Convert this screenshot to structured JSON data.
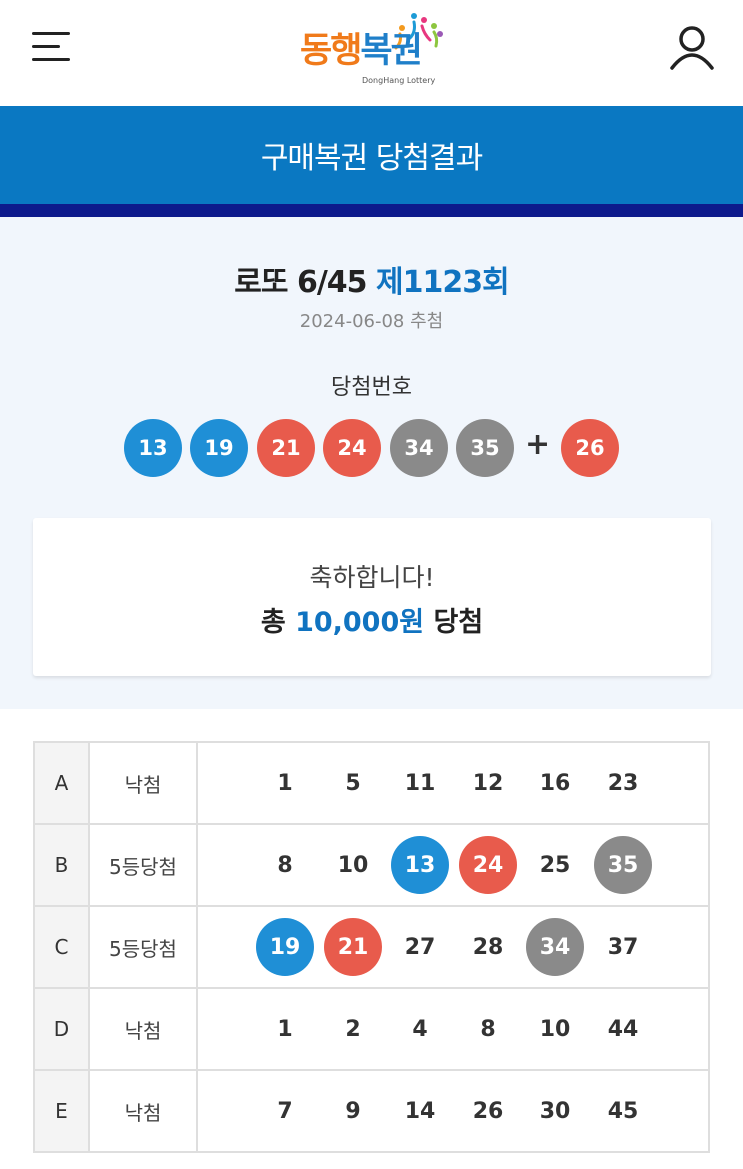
{
  "header": {
    "logo": {
      "text_1": "동행",
      "text_2": "복권",
      "subtitle": "DongHang Lottery"
    }
  },
  "title_bar": {
    "title": "구매복권 당첨결과"
  },
  "summary": {
    "game_name": "로또 6/45",
    "round": "제1123회",
    "draw_date": "2024-06-08 추첨",
    "winning_label": "당첨번호",
    "winning_numbers": [
      {
        "value": "13",
        "color": "#1f8fd6"
      },
      {
        "value": "19",
        "color": "#1f8fd6"
      },
      {
        "value": "21",
        "color": "#e85b4c"
      },
      {
        "value": "24",
        "color": "#e85b4c"
      },
      {
        "value": "34",
        "color": "#8a8a8a"
      },
      {
        "value": "35",
        "color": "#8a8a8a"
      }
    ],
    "plus_sign": "+",
    "bonus_number": {
      "value": "26",
      "color": "#e85b4c"
    },
    "congrats_text": "축하합니다!",
    "total_prefix": "총",
    "total_amount": "10,000원",
    "total_suffix": "당첨"
  },
  "games": [
    {
      "label": "A",
      "status": "낙첨",
      "numbers": [
        {
          "value": "1",
          "hit": false
        },
        {
          "value": "5",
          "hit": false
        },
        {
          "value": "11",
          "hit": false
        },
        {
          "value": "12",
          "hit": false
        },
        {
          "value": "16",
          "hit": false
        },
        {
          "value": "23",
          "hit": false
        }
      ]
    },
    {
      "label": "B",
      "status": "5등당첨",
      "numbers": [
        {
          "value": "8",
          "hit": false
        },
        {
          "value": "10",
          "hit": false
        },
        {
          "value": "13",
          "hit": true,
          "color": "#1f8fd6"
        },
        {
          "value": "24",
          "hit": true,
          "color": "#e85b4c"
        },
        {
          "value": "25",
          "hit": false
        },
        {
          "value": "35",
          "hit": true,
          "color": "#8a8a8a"
        }
      ]
    },
    {
      "label": "C",
      "status": "5등당첨",
      "numbers": [
        {
          "value": "19",
          "hit": true,
          "color": "#1f8fd6"
        },
        {
          "value": "21",
          "hit": true,
          "color": "#e85b4c"
        },
        {
          "value": "27",
          "hit": false
        },
        {
          "value": "28",
          "hit": false
        },
        {
          "value": "34",
          "hit": true,
          "color": "#8a8a8a"
        },
        {
          "value": "37",
          "hit": false
        }
      ]
    },
    {
      "label": "D",
      "status": "낙첨",
      "numbers": [
        {
          "value": "1",
          "hit": false
        },
        {
          "value": "2",
          "hit": false
        },
        {
          "value": "4",
          "hit": false
        },
        {
          "value": "8",
          "hit": false
        },
        {
          "value": "10",
          "hit": false
        },
        {
          "value": "44",
          "hit": false
        }
      ]
    },
    {
      "label": "E",
      "status": "낙첨",
      "numbers": [
        {
          "value": "7",
          "hit": false
        },
        {
          "value": "9",
          "hit": false
        },
        {
          "value": "14",
          "hit": false
        },
        {
          "value": "26",
          "hit": false
        },
        {
          "value": "30",
          "hit": false
        },
        {
          "value": "45",
          "hit": false
        }
      ]
    }
  ],
  "colors": {
    "brand_blue": "#0a78c2",
    "accent_navy": "#0d1a8c",
    "highlight_blue": "#1073c0"
  },
  "icons": {
    "menu": "hamburger-menu-icon",
    "user": "user-profile-icon"
  }
}
